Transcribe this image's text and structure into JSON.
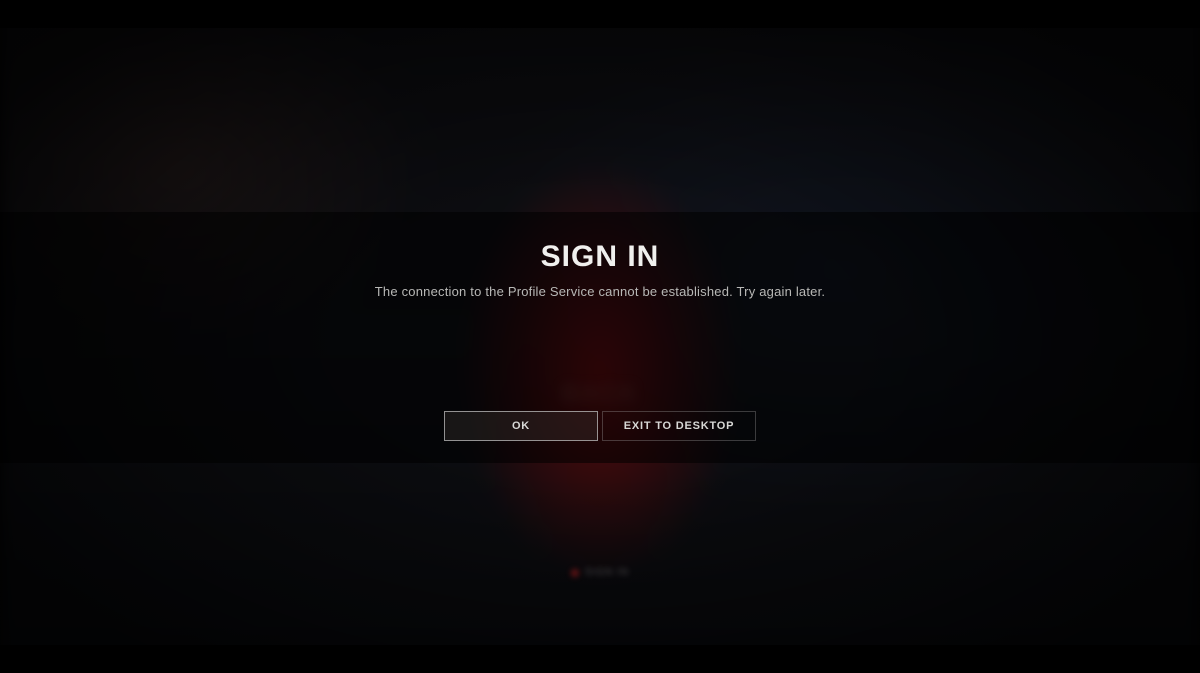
{
  "dialog": {
    "title": "SIGN IN",
    "message": "The connection to the Profile Service cannot be established. Try again later.",
    "buttons": {
      "ok": "OK",
      "exit": "EXIT TO DESKTOP"
    }
  },
  "background": {
    "hint_label": "SIGN IN"
  }
}
